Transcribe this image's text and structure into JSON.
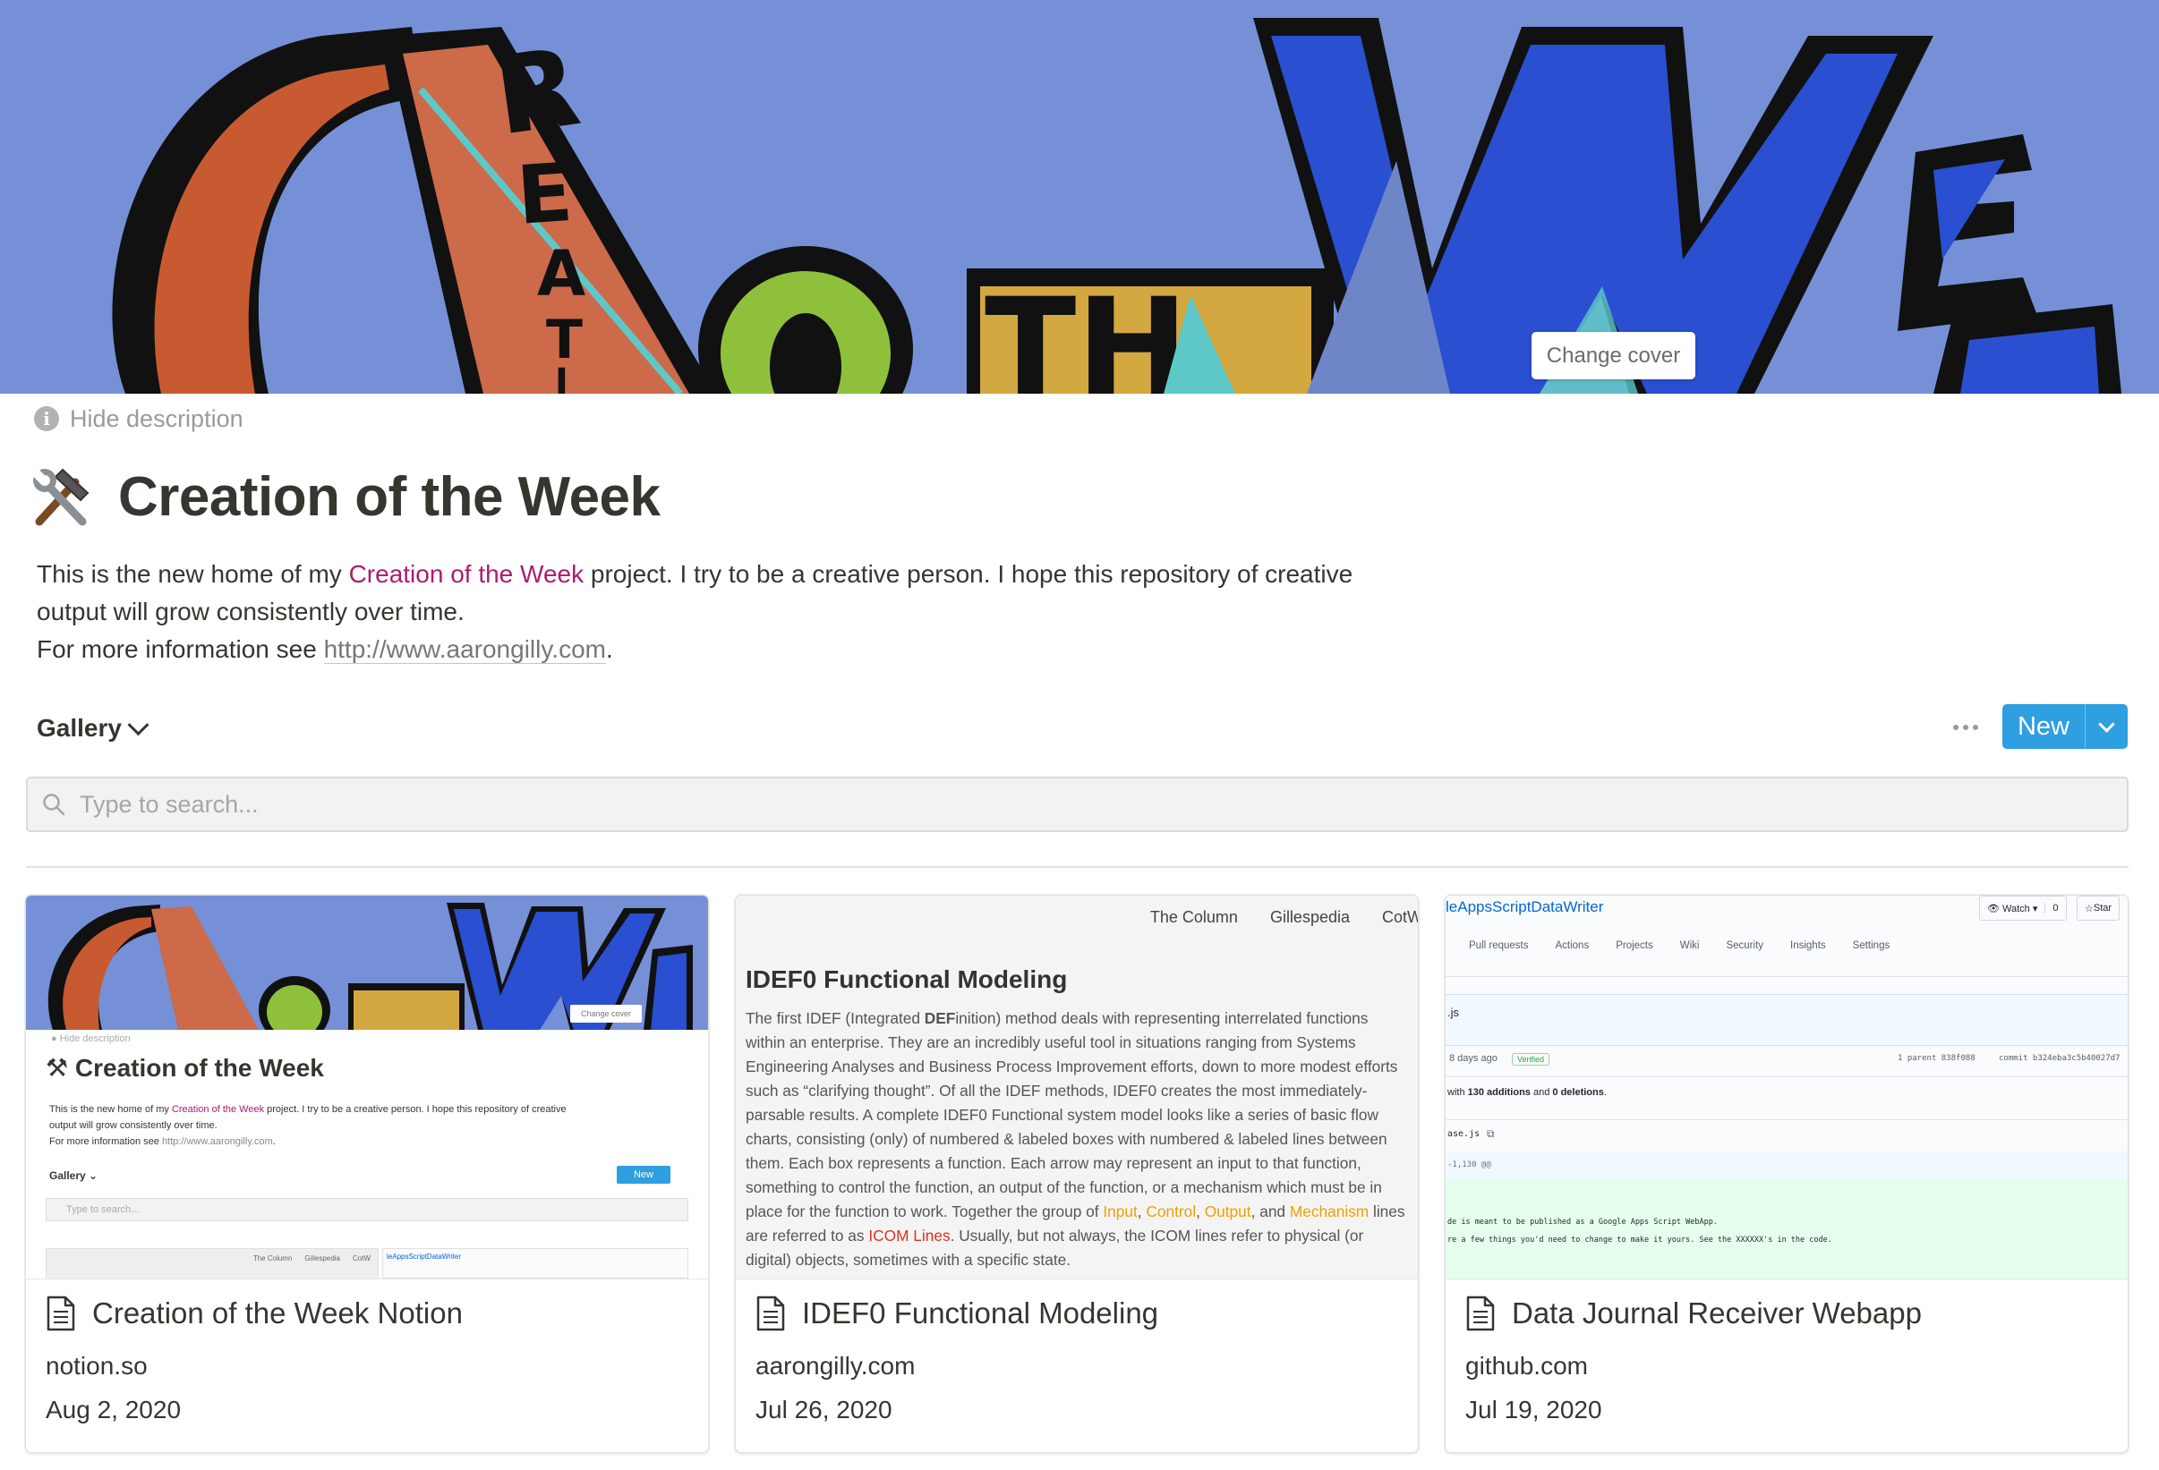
{
  "cover": {
    "change_cover_label": "Change cover",
    "colors": {
      "background": "#7590d6",
      "orange": "#c85a32",
      "green": "#8fc03c",
      "yellow": "#d4a840",
      "blue": "#2a4fd0"
    }
  },
  "header": {
    "hide_description_label": "Hide description",
    "title_icon": "hammer-and-wrench-icon",
    "title": "Creation of the Week",
    "description": {
      "line1_prefix": "This is the new home of my ",
      "line1_highlight": "Creation of the Week",
      "line1_suffix": " project. I try to be a creative person. I hope this repository of creative",
      "line2": "output will grow consistently over time.",
      "line3_prefix": "For more information see ",
      "line3_link": "http://www.aarongilly.com",
      "line3_suffix": "."
    }
  },
  "view_bar": {
    "view_name": "Gallery",
    "more_icon": "ellipsis-icon",
    "new_label": "New"
  },
  "search": {
    "placeholder": "Type to search..."
  },
  "cards": [
    {
      "title": "Creation of the Week Notion",
      "url": "notion.so",
      "date": "Aug 2, 2020",
      "preview": {
        "change_cover": "Change cover",
        "hide_description": "Hide description",
        "title": "Creation of the Week",
        "desc_prefix": "This is the new home of my ",
        "desc_highlight": "Creation of the Week",
        "desc_suffix": " project. I try to be a creative person. I hope this repository of creative",
        "desc_line2": "output will grow consistently over time.",
        "desc_line3_prefix": "For more information see ",
        "desc_line3_link": "http://www.aarongilly.com",
        "desc_line3_suffix": ".",
        "gallery": "Gallery",
        "new": "New",
        "search": "Type to search...",
        "nav1": "The Column",
        "nav2": "Gillespedia",
        "nav3": "CotW",
        "repo": "leAppsScriptDataWriter"
      }
    },
    {
      "title": "IDEF0 Functional Modeling",
      "url": "aarongilly.com",
      "date": "Jul 26, 2020",
      "preview": {
        "nav": [
          "The Column",
          "Gillespedia",
          "CotW"
        ],
        "heading": "IDEF0 Functional Modeling",
        "p_start": "The first IDEF (Integrated ",
        "p_bold": "DEF",
        "p_mid": "inition) method deals with representing interrelated functions within an enterprise. They are an incredibly useful tool in situations ranging from Systems Engineering Analyses and Business Process Improvement efforts, down to more modest efforts such as “clarifying thought”. Of all the IDEF methods, IDEF0 creates the most immediately-parsable results. A complete IDEF0 Functional system model looks like a series of basic flow charts, consisting (only) of numbered & labeled boxes with numbered & labeled lines between them. Each box represents a function. Each arrow may represent an input to that function, something to control the function, an output of the function, or a mechanism which must be in place for the function to work. Together the group of ",
        "input": "Input",
        "sep1": ", ",
        "control": "Control",
        "sep2": ", ",
        "output": "Output",
        "sep3": ",",
        "and": " and ",
        "mechanism": "Mechanism",
        "p_mid2": " lines are referred to as ",
        "icom": "ICOM Lines",
        "p_end": ". Usually, but not always, the ICOM lines refer to physical (or digital) objects, sometimes with a specific state."
      }
    },
    {
      "title": "Data Journal Receiver Webapp",
      "url": "github.com",
      "date": "Jul 19, 2020",
      "preview": {
        "repo": "leAppsScriptDataWriter",
        "watch": "Watch",
        "watch_count": "0",
        "star": "Star",
        "tabs": [
          "Pull requests",
          "Actions",
          "Projects",
          "Wiki",
          "Security",
          "Insights",
          "Settings"
        ],
        "file": ".js",
        "ago": "8 days ago",
        "verified": "Verified",
        "parent": "1 parent 838f088",
        "commit": "commit b324eba3c5b40027d7",
        "stats_prefix": "with ",
        "additions": "130 additions",
        "stats_mid": " and ",
        "deletions": "0 deletions",
        "stats_suffix": ".",
        "file2": "ase.js",
        "hunk": "-1,130 @@",
        "diff1": "de is meant to be published as a Google Apps Script WebApp.",
        "diff2": "re a few things you'd need to change to make it yours. See the XXXXXX's in the code."
      }
    }
  ]
}
